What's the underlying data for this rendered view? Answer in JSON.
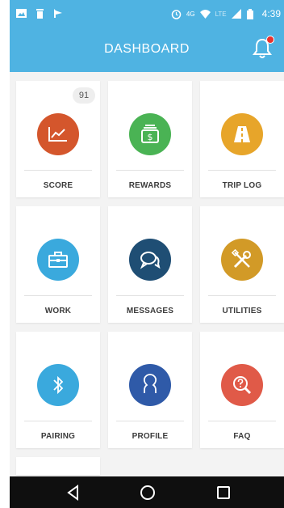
{
  "status_bar": {
    "network_label": "4G",
    "lte_label": "LTE",
    "time": "4:39"
  },
  "header": {
    "title": "DASHBOARD",
    "notification_icon": "bell-icon"
  },
  "tiles": [
    {
      "label": "SCORE",
      "icon": "trend-chart-icon",
      "color": "#d4562c",
      "badge": "91"
    },
    {
      "label": "REWARDS",
      "icon": "cash-icon",
      "color": "#4ab354"
    },
    {
      "label": "TRIP LOG",
      "icon": "road-icon",
      "color": "#e7a52a"
    },
    {
      "label": "WORK",
      "icon": "briefcase-icon",
      "color": "#3aa9dd"
    },
    {
      "label": "MESSAGES",
      "icon": "chat-bubbles-icon",
      "color": "#1f4e74"
    },
    {
      "label": "UTILITIES",
      "icon": "tools-icon",
      "color": "#d29a27"
    },
    {
      "label": "PAIRING",
      "icon": "bluetooth-icon",
      "color": "#3aa9dd"
    },
    {
      "label": "PROFILE",
      "icon": "person-outline-icon",
      "color": "#2f5aa8"
    },
    {
      "label": "FAQ",
      "icon": "search-help-icon",
      "color": "#e05a48"
    }
  ],
  "nav_bar": {
    "back": "back-icon",
    "home": "home-icon",
    "recents": "recents-icon"
  }
}
